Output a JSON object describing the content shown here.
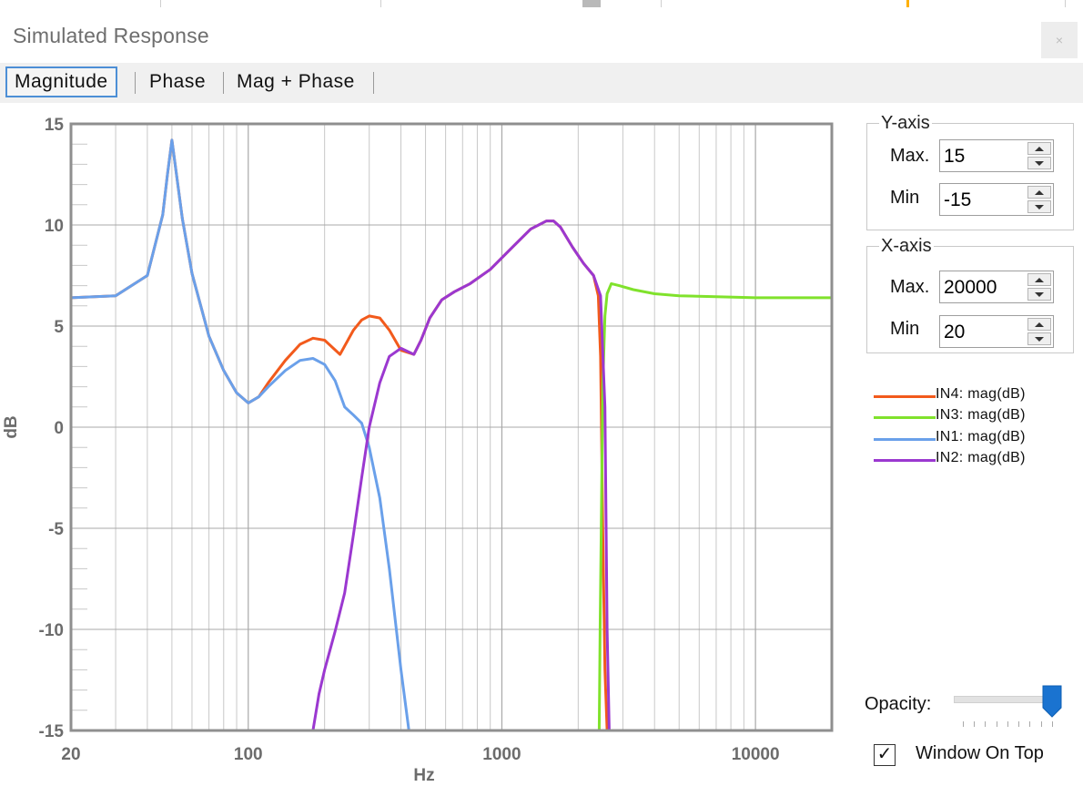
{
  "window": {
    "title": "Simulated Response",
    "close_glyph": "×"
  },
  "tabs": [
    {
      "label": "Magnitude",
      "active": true
    },
    {
      "label": "Phase",
      "active": false
    },
    {
      "label": "Mag + Phase",
      "active": false
    }
  ],
  "chart_data": {
    "type": "line",
    "xlabel": "Hz",
    "ylabel": "dB",
    "xscale": "log",
    "xlim": [
      20,
      20000
    ],
    "ylim": [
      -15,
      15
    ],
    "x_ticks": [
      "20",
      "100",
      "1000",
      "10000"
    ],
    "x_tick_values": [
      20,
      100,
      1000,
      10000
    ],
    "y_ticks": [
      "15",
      "10",
      "5",
      "0",
      "-5",
      "-10",
      "-15"
    ],
    "y_tick_values": [
      15,
      10,
      5,
      0,
      -5,
      -10,
      -15
    ],
    "grid": true,
    "legend_position": "right",
    "series": [
      {
        "name": "IN4: mag(dB)",
        "color": "#f25a1c",
        "x": [
          20,
          30,
          40,
          46,
          48,
          50,
          55,
          60,
          70,
          80,
          90,
          100,
          110,
          120,
          140,
          160,
          180,
          200,
          230,
          260,
          280,
          300,
          330,
          360,
          400,
          450,
          480,
          520,
          580,
          650,
          750,
          900,
          1100,
          1300,
          1500,
          1600,
          1700,
          1900,
          2100,
          2300,
          2400,
          2450,
          2500,
          2550,
          2600
        ],
        "y": [
          6.4,
          6.5,
          7.5,
          10.5,
          12.5,
          14.2,
          10.3,
          7.6,
          4.5,
          2.8,
          1.7,
          1.2,
          1.5,
          2.2,
          3.3,
          4.1,
          4.4,
          4.3,
          3.6,
          4.8,
          5.3,
          5.5,
          5.4,
          4.8,
          3.8,
          3.6,
          4.3,
          5.4,
          6.3,
          6.7,
          7.1,
          7.8,
          8.9,
          9.8,
          10.2,
          10.2,
          9.9,
          8.9,
          8.1,
          7.5,
          6.5,
          3.5,
          -5,
          -12,
          -15
        ]
      },
      {
        "name": "IN3: mag(dB)",
        "color": "#80e22c",
        "x": [
          2420,
          2440,
          2470,
          2500,
          2550,
          2600,
          2700,
          2900,
          3300,
          4000,
          5000,
          7000,
          10000,
          15000,
          20000
        ],
        "y": [
          -15,
          -10,
          -4,
          2,
          5.5,
          6.6,
          7.1,
          7.0,
          6.8,
          6.6,
          6.5,
          6.45,
          6.4,
          6.4,
          6.4
        ]
      },
      {
        "name": "IN1: mag(dB)",
        "color": "#6aa0ea",
        "x": [
          20,
          30,
          40,
          46,
          48,
          50,
          55,
          60,
          70,
          80,
          90,
          100,
          110,
          120,
          140,
          160,
          180,
          200,
          220,
          240,
          260,
          280,
          300,
          330,
          360,
          400,
          430
        ],
        "y": [
          6.4,
          6.5,
          7.5,
          10.5,
          12.5,
          14.2,
          10.3,
          7.6,
          4.5,
          2.8,
          1.7,
          1.2,
          1.5,
          2.0,
          2.8,
          3.3,
          3.4,
          3.1,
          2.3,
          1.0,
          0.6,
          0.2,
          -1.0,
          -3.5,
          -7.0,
          -12.0,
          -15
        ]
      },
      {
        "name": "IN2: mag(dB)",
        "color": "#9b38d0",
        "x": [
          180,
          190,
          200,
          220,
          240,
          260,
          280,
          300,
          330,
          360,
          400,
          450,
          480,
          520,
          580,
          650,
          750,
          900,
          1100,
          1300,
          1500,
          1600,
          1700,
          1900,
          2100,
          2300,
          2450,
          2550,
          2600,
          2650
        ],
        "y": [
          -15,
          -13.2,
          -12.0,
          -10.1,
          -8.2,
          -5.3,
          -2.5,
          0.0,
          2.2,
          3.5,
          3.9,
          3.6,
          4.3,
          5.4,
          6.3,
          6.7,
          7.1,
          7.8,
          8.9,
          9.8,
          10.2,
          10.2,
          9.9,
          8.9,
          8.1,
          7.5,
          6.5,
          1.0,
          -10.0,
          -15
        ]
      }
    ]
  },
  "y_axis": {
    "legend": "Y-axis",
    "max_label": "Max.",
    "max_value": "15",
    "min_label": "Min",
    "min_value": "-15"
  },
  "x_axis": {
    "legend": "X-axis",
    "max_label": "Max.",
    "max_value": "20000",
    "min_label": "Min",
    "min_value": "20"
  },
  "legend": [
    {
      "label": "IN4: mag(dB)",
      "color": "#f25a1c"
    },
    {
      "label": "IN3: mag(dB)",
      "color": "#80e22c"
    },
    {
      "label": "IN1: mag(dB)",
      "color": "#6aa0ea"
    },
    {
      "label": "IN2: mag(dB)",
      "color": "#9b38d0"
    }
  ],
  "opacity": {
    "label": "Opacity:",
    "value_fraction": 0.95
  },
  "window_on_top": {
    "label": "Window On Top",
    "checked": true,
    "check_glyph": "✓"
  },
  "colors": {
    "plot_border": "#8f8f8f",
    "grid": "#c8c8c8",
    "axis_text": "#6c6c6c",
    "accent": "#1a73d0"
  }
}
